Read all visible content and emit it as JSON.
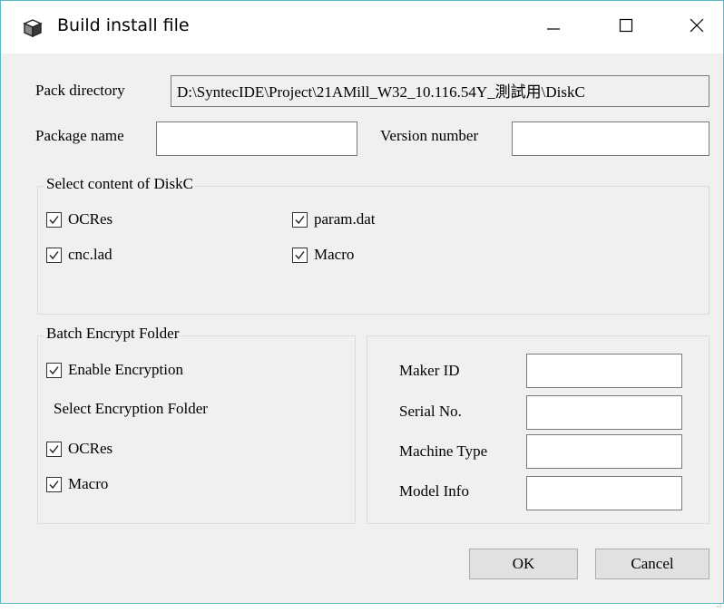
{
  "window": {
    "title": "Build install file",
    "icon": "package-box-icon",
    "minimize_icon": "minimize-icon",
    "maximize_icon": "maximize-icon",
    "close_icon": "close-icon"
  },
  "pack_directory": {
    "label": "Pack directory",
    "value": "D:\\SyntecIDE\\Project\\21AMill_W32_10.116.54Y_測試用\\DiskC"
  },
  "package_name": {
    "label": "Package name",
    "value": ""
  },
  "version_number": {
    "label": "Version number",
    "value": ""
  },
  "content_group": {
    "title": "Select content of DiskC",
    "items": [
      {
        "label": "OCRes",
        "checked": true
      },
      {
        "label": "param.dat",
        "checked": true
      },
      {
        "label": "cnc.lad",
        "checked": true
      },
      {
        "label": "Macro",
        "checked": true
      }
    ]
  },
  "encrypt_group": {
    "title": "Batch Encrypt Folder",
    "enable": {
      "label": "Enable Encryption",
      "checked": true
    },
    "select_label": "Select Encryption Folder",
    "folders": [
      {
        "label": "OCRes",
        "checked": true
      },
      {
        "label": "Macro",
        "checked": true
      }
    ]
  },
  "machine_info": {
    "maker_id": {
      "label": "Maker ID",
      "value": ""
    },
    "serial_no": {
      "label": "Serial No.",
      "value": ""
    },
    "machine_type": {
      "label": "Machine Type",
      "value": ""
    },
    "model_info": {
      "label": "Model Info",
      "value": ""
    }
  },
  "buttons": {
    "ok": "OK",
    "cancel": "Cancel"
  }
}
